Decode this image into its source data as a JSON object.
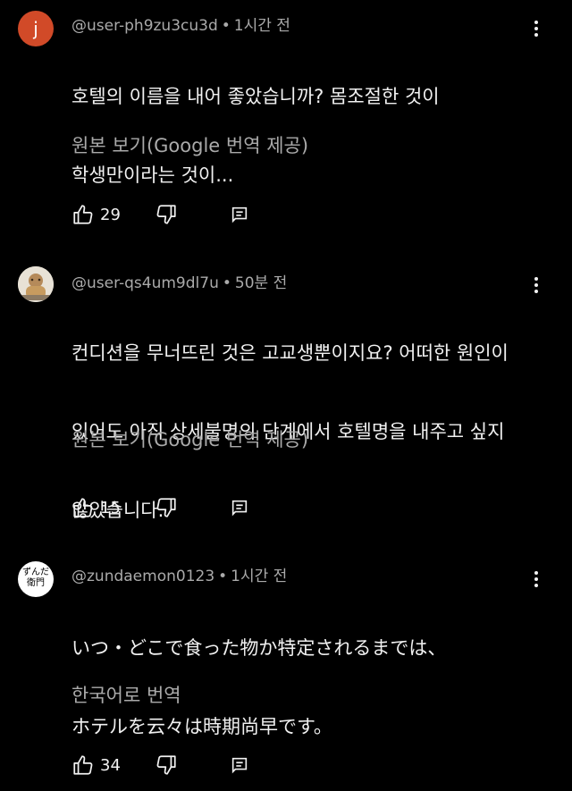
{
  "comments": [
    {
      "avatar_letter": "j",
      "avatar_color": "#d14a28",
      "username": "@user-ph9zu3cu3d",
      "time": "1시간 전",
      "text_lines": [
        "호텔의 이름을 내어 좋았습니까? 몸조절한 것이",
        "학생만이라는 것이..."
      ],
      "translate_label": "원본 보기(Google 번역 제공)",
      "like_count": "29"
    },
    {
      "avatar_icon": "profile-photo",
      "username": "@user-qs4um9dl7u",
      "time": "50분 전",
      "text_lines": [
        "컨디션을 무너뜨린 것은 고교생뿐이지요? 어떠한 원인이",
        "있어도 아직 상세불명의 단계에서 호텔명을 내주고 싶지",
        "않았습니다."
      ],
      "translate_label": "원본 보기(Google 번역 제공)",
      "like_count": "15"
    },
    {
      "avatar_text": "ずんだ\n衛門",
      "username": "@zundaemon0123",
      "time": "1시간 전",
      "text_lines": [
        "いつ・どこで食った物か特定されるまでは、",
        "ホテルを云々は時期尚早です。"
      ],
      "translate_label": "한국어로 번역",
      "like_count": "34"
    }
  ],
  "icons": {
    "like": "thumbs-up-icon",
    "dislike": "thumbs-down-icon",
    "reply": "reply-icon",
    "menu": "more-vert-icon"
  }
}
